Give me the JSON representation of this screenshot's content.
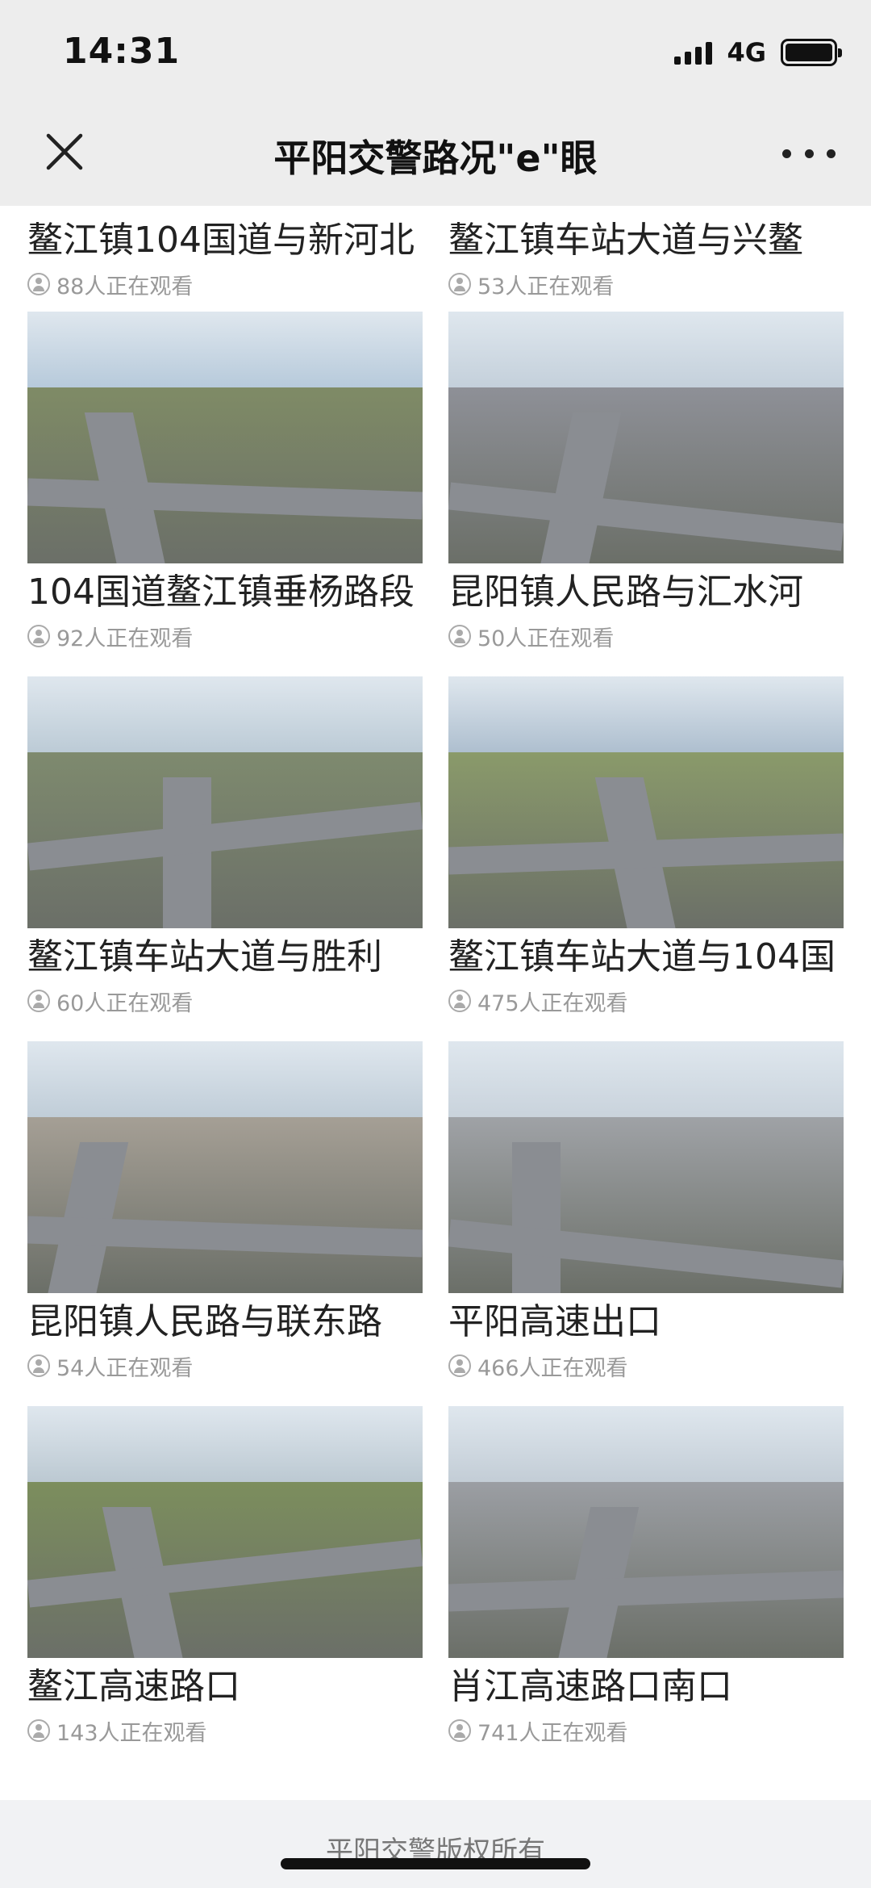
{
  "status": {
    "time": "14:31",
    "network": "4G"
  },
  "header": {
    "title": "平阳交警路况\"e\"眼",
    "close_icon": "close-icon",
    "more_icon": "more-dots-icon"
  },
  "cameras": [
    {
      "title": "鳌江镇104国道与新河北",
      "viewers": "88人正在观看"
    },
    {
      "title": "鳌江镇车站大道与兴鳌",
      "viewers": "53人正在观看"
    },
    {
      "title": "104国道鳌江镇垂杨路段",
      "viewers": "92人正在观看"
    },
    {
      "title": "昆阳镇人民路与汇水河",
      "viewers": "50人正在观看"
    },
    {
      "title": "鳌江镇车站大道与胜利",
      "viewers": "60人正在观看"
    },
    {
      "title": "鳌江镇车站大道与104国",
      "viewers": "475人正在观看"
    },
    {
      "title": "昆阳镇人民路与联东路",
      "viewers": "54人正在观看"
    },
    {
      "title": "平阳高速出口",
      "viewers": "466人正在观看"
    },
    {
      "title": "鳌江高速路口",
      "viewers": "143人正在观看"
    },
    {
      "title": "肖江高速路口南口",
      "viewers": "741人正在观看"
    }
  ],
  "footer": {
    "text": "平阳交警版权所有"
  },
  "colors": {
    "header_bg": "#ededed",
    "footer_bg": "#f1f2f4",
    "muted": "#999999"
  }
}
